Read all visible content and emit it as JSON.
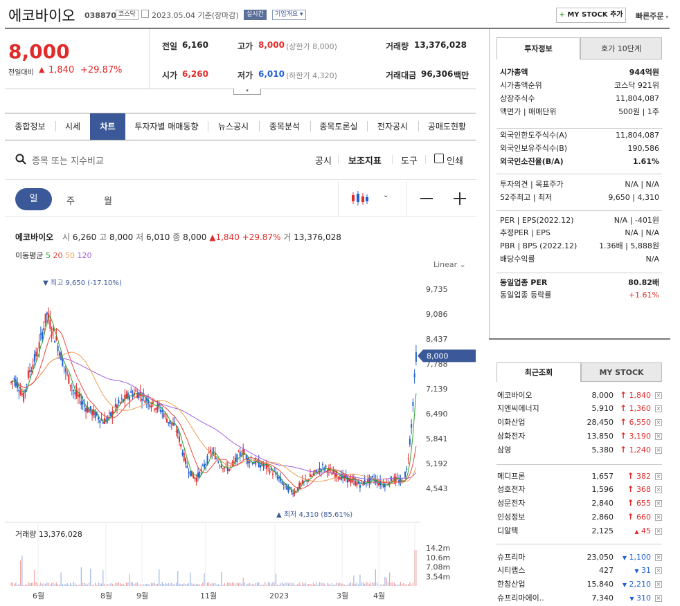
{
  "stock": {
    "name": "에코바이오",
    "code": "038870",
    "market": "코스닥",
    "date_text": "2023.05.04 기준(장마감)",
    "realtime": "실시간",
    "company_info": "기업개요",
    "price": "8,000",
    "change_label": "전일대비",
    "change": "1,840",
    "change_pct": "+29.87%"
  },
  "top_buttons": {
    "mystock": "MY STOCK 추가",
    "quick_order": "빠른주문"
  },
  "quote": {
    "prev_label": "전일",
    "prev": "6,160",
    "high_label": "고가",
    "high": "8,000",
    "high_note": "(상한가 8,000)",
    "volume_label": "거래량",
    "volume": "13,376,028",
    "open_label": "시가",
    "open": "6,260",
    "low_label": "저가",
    "low": "6,010",
    "low_note": "(하한가 4,320)",
    "amount_label": "거래대금",
    "amount": "96,306",
    "amount_unit": "백만"
  },
  "tabs": [
    "종합정보",
    "시세",
    "차트",
    "투자자별 매매동향",
    "뉴스공시",
    "종목분석",
    "종목토론실",
    "전자공시",
    "공매도현황"
  ],
  "toolbar": {
    "search_placeholder": "종목 또는 지수비교",
    "disclosure": "공시",
    "indicator": "보조지표",
    "tools": "도구",
    "print": "인쇄"
  },
  "periods": [
    "일",
    "주",
    "월"
  ],
  "chart_info": {
    "name": "에코바이오",
    "open_l": "시",
    "open": "6,260",
    "high_l": "고",
    "high": "8,000",
    "low_l": "저",
    "low": "6,010",
    "close_l": "종",
    "close": "8,000",
    "change": "▲1,840 +29.87%",
    "vol_l": "거",
    "vol": "13,376,028",
    "ma_label": "이동평균",
    "ma": [
      "5",
      "20",
      "50",
      "120"
    ],
    "scale": "Linear",
    "max_label": "최고 9,650 (-17.10%)",
    "min_label": "최저 4,310 (85.61%)",
    "volume_label": "거래량 13,376,028",
    "price_tag": "8,000"
  },
  "colors": {
    "up": "#e12b2b",
    "down": "#1f5fd1",
    "ma5": "#2ca02c",
    "ma20": "#e8453c",
    "ma50": "#f0a050",
    "ma120": "#a060e0",
    "accent": "#3b5998"
  },
  "chart_data": {
    "type": "candlestick",
    "y_ticks": [
      "9,735",
      "9,086",
      "8,437",
      "7,788",
      "7,139",
      "6,490",
      "5,841",
      "5,192",
      "4,543"
    ],
    "volume_ticks": [
      "14.2m",
      "10.6m",
      "7.08m",
      "3.54m"
    ],
    "x_ticks": [
      "6월",
      "8월",
      "9월",
      "11월",
      "2023",
      "3월",
      "4월"
    ],
    "ylim": [
      4200,
      9900
    ],
    "close_series": [
      7400,
      7200,
      6900,
      7500,
      7800,
      8100,
      8600,
      9100,
      8700,
      8400,
      8000,
      7600,
      7300,
      7000,
      6900,
      6700,
      6600,
      6500,
      6400,
      6300,
      6350,
      6500,
      6700,
      6800,
      6900,
      7000,
      7050,
      7000,
      6900,
      6800,
      6700,
      6650,
      6500,
      6300,
      6200,
      6000,
      5500,
      5100,
      4900,
      4800,
      5000,
      5200,
      5500,
      5400,
      5200,
      5100,
      5050,
      5200,
      5400,
      5500,
      5300,
      5250,
      5200,
      5150,
      5100,
      5000,
      4900,
      4750,
      4600,
      4500,
      4450,
      4600,
      4700,
      4800,
      4900,
      5000,
      5100,
      5050,
      4950,
      4900,
      4850,
      4800,
      4750,
      4700,
      4650,
      4700,
      4750,
      4800,
      4700,
      4650,
      4700,
      4800,
      4750,
      4700,
      5000,
      6200,
      8000
    ],
    "ma": {
      "ma5": "5",
      "ma20": "20",
      "ma50": "50",
      "ma120": "120"
    }
  },
  "tabs_right": [
    "투자정보",
    "호가 10단계"
  ],
  "invest": [
    {
      "label": "시가총액",
      "value": "944억원",
      "bold": true
    },
    {
      "label": "시가총액순위",
      "value": "코스닥 921위"
    },
    {
      "label": "상장주식수",
      "value": "11,804,087"
    },
    {
      "label": "액면가 | 매매단위",
      "value": "500원 | 1주"
    },
    {
      "label": "외국인한도주식수(A)",
      "value": "11,804,087"
    },
    {
      "label": "외국인보유주식수(B)",
      "value": "190,586"
    },
    {
      "label": "외국인소진율(B/A)",
      "value": "1.61%",
      "bold": true
    },
    {
      "label": "투자의견 | 목표주가",
      "value": "N/A | N/A"
    },
    {
      "label": "52주최고 | 최저",
      "value": "9,650 | 4,310"
    },
    {
      "label": "PER | EPS(2022.12)",
      "value": "N/A | -401원"
    },
    {
      "label": "추정PER | EPS",
      "value": "N/A | N/A"
    },
    {
      "label": "PBR | BPS (2022.12)",
      "value": "1.36배 | 5,888원"
    },
    {
      "label": "배당수익률",
      "value": "N/A"
    },
    {
      "label": "동일업종 PER",
      "value": "80.82배",
      "bold": true
    },
    {
      "label": "동일업종 등락률",
      "value": "+1.61%"
    }
  ],
  "recent_tabs": [
    "최근조회",
    "MY STOCK"
  ],
  "recent": [
    {
      "name": "에코바이오",
      "price": "8,000",
      "change": "1,840"
    },
    {
      "name": "지엔씨에너지",
      "price": "5,910",
      "change": "1,360"
    },
    {
      "name": "이화산업",
      "price": "28,450",
      "change": "6,550"
    },
    {
      "name": "삼화전자",
      "price": "13,850",
      "change": "3,190"
    },
    {
      "name": "삼영",
      "price": "5,380",
      "change": "1,240"
    },
    {
      "name": "메디프론",
      "price": "1,657",
      "change": "382"
    },
    {
      "name": "성호전자",
      "price": "1,596",
      "change": "368"
    },
    {
      "name": "성문전자",
      "price": "2,840",
      "change": "655"
    },
    {
      "name": "인성정보",
      "price": "2,860",
      "change": "660"
    },
    {
      "name": "디알텍",
      "price": "2,125",
      "change": "45"
    },
    {
      "name": "슈프리마",
      "price": "23,050",
      "change": "1,100"
    },
    {
      "name": "시티랩스",
      "price": "427",
      "change": "31"
    },
    {
      "name": "한창산업",
      "price": "15,840",
      "change": "2,210"
    },
    {
      "name": "슈프리마에이..",
      "price": "7,340",
      "change": "310"
    }
  ]
}
